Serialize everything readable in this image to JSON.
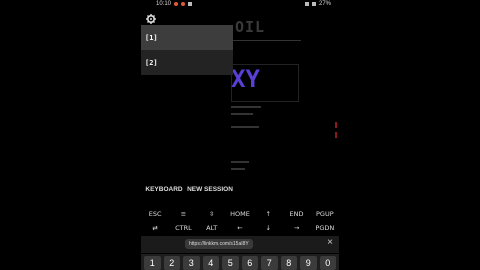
{
  "status_bar": {
    "time": "10:10",
    "battery": "27%"
  },
  "terminal": {
    "banner": "OIL",
    "art": "XY"
  },
  "drawer": {
    "sessions": [
      {
        "label": "[1]"
      },
      {
        "label": "[2]"
      }
    ],
    "keyboard_button": "KEYBOARD",
    "new_session_button": "NEW SESSION"
  },
  "extra_keys": {
    "row1": [
      "ESC",
      "≡",
      "⇳",
      "HOME",
      "↑",
      "END",
      "PGUP"
    ],
    "row2": [
      "⇄",
      "CTRL",
      "ALT",
      "←",
      "↓",
      "→",
      "PGDN"
    ]
  },
  "clipboard": {
    "url": "https://linkkm.com/s15aI8Y",
    "close": "×"
  },
  "number_row": [
    "1",
    "2",
    "3",
    "4",
    "5",
    "6",
    "7",
    "8",
    "9",
    "0"
  ],
  "colors": {
    "accent_purple": "#5a3fd6",
    "session_active": "#3d3d3d"
  }
}
